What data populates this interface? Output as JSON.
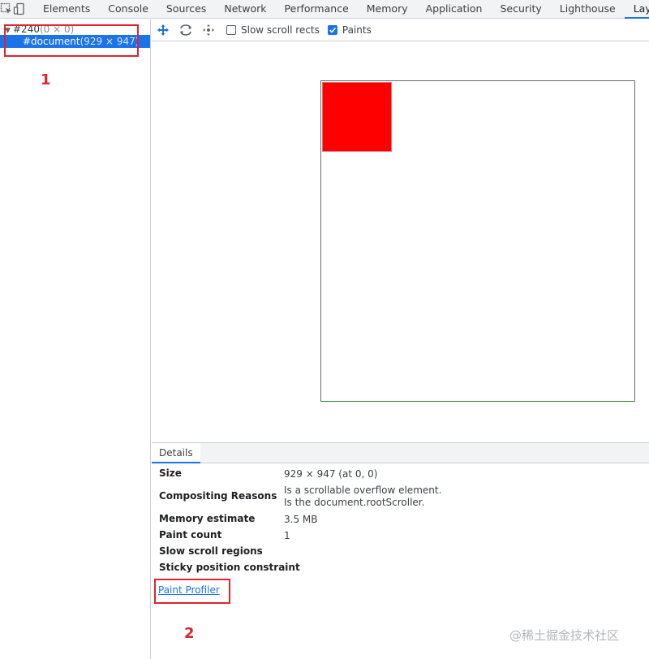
{
  "tabs": [
    {
      "label": "Elements",
      "active": false
    },
    {
      "label": "Console",
      "active": false
    },
    {
      "label": "Sources",
      "active": false
    },
    {
      "label": "Network",
      "active": false
    },
    {
      "label": "Performance",
      "active": false
    },
    {
      "label": "Memory",
      "active": false
    },
    {
      "label": "Application",
      "active": false
    },
    {
      "label": "Security",
      "active": false
    },
    {
      "label": "Lighthouse",
      "active": false
    },
    {
      "label": "Layers",
      "active": true
    }
  ],
  "tab_close": "×",
  "tree": {
    "root": {
      "name": "#240",
      "size": "(0 × 0)"
    },
    "child": {
      "name": "#document",
      "size": "(929 × 947)"
    }
  },
  "toolbar": {
    "icons": [
      "pan-mode-icon",
      "rotate-mode-icon",
      "reset-transform-icon"
    ],
    "slow_scroll_label": "Slow scroll rects",
    "slow_scroll_checked": false,
    "paints_label": "Paints",
    "paints_checked": true
  },
  "details": {
    "tab_label": "Details",
    "rows": [
      {
        "key": "Size",
        "value": "929 × 947 (at 0, 0)"
      },
      {
        "key": "Compositing Reasons",
        "value": "Is a scrollable overflow element.",
        "value2": "Is the document.rootScroller."
      },
      {
        "key": "Memory estimate",
        "value": "3.5 MB"
      },
      {
        "key": "Paint count",
        "value": "1"
      },
      {
        "key": "Slow scroll regions",
        "value": ""
      },
      {
        "key": "Sticky position constraint",
        "value": ""
      }
    ],
    "paint_profiler_link": "Paint Profiler"
  },
  "annotations": {
    "one": "1",
    "two": "2"
  },
  "watermark": "@稀土掘金技术社区",
  "colors": {
    "accent": "#1a73e8",
    "annotation": "#e0232e",
    "layer_fill": "#ff0000"
  }
}
